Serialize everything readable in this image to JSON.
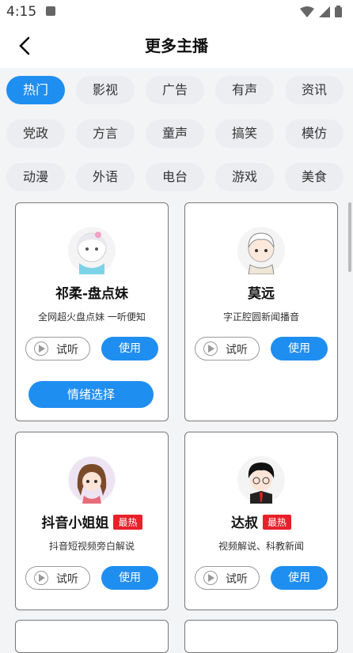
{
  "status": {
    "time": "4:15"
  },
  "header": {
    "title": "更多主播"
  },
  "categories": [
    "热门",
    "影视",
    "广告",
    "有声",
    "资讯",
    "党政",
    "方言",
    "童声",
    "搞笑",
    "模仿",
    "动漫",
    "外语",
    "电台",
    "游戏",
    "美食"
  ],
  "cards": [
    {
      "name": "祁柔-盘点妹",
      "badge": "",
      "desc": "全网超火盘点妹 一听便知",
      "listen": "试听",
      "use": "使用",
      "mood": "情绪选择"
    },
    {
      "name": "莫远",
      "badge": "",
      "desc": "字正腔圆新闻播音",
      "listen": "试听",
      "use": "使用"
    },
    {
      "name": "抖音小姐姐",
      "badge": "最热",
      "desc": "抖音短视频旁白解说",
      "listen": "试听",
      "use": "使用"
    },
    {
      "name": "达叔",
      "badge": "最热",
      "desc": "视频解说、科教新闻",
      "listen": "试听",
      "use": "使用"
    }
  ],
  "colors": {
    "accent": "#1f8ef1",
    "hot_badge": "#e8202a"
  }
}
